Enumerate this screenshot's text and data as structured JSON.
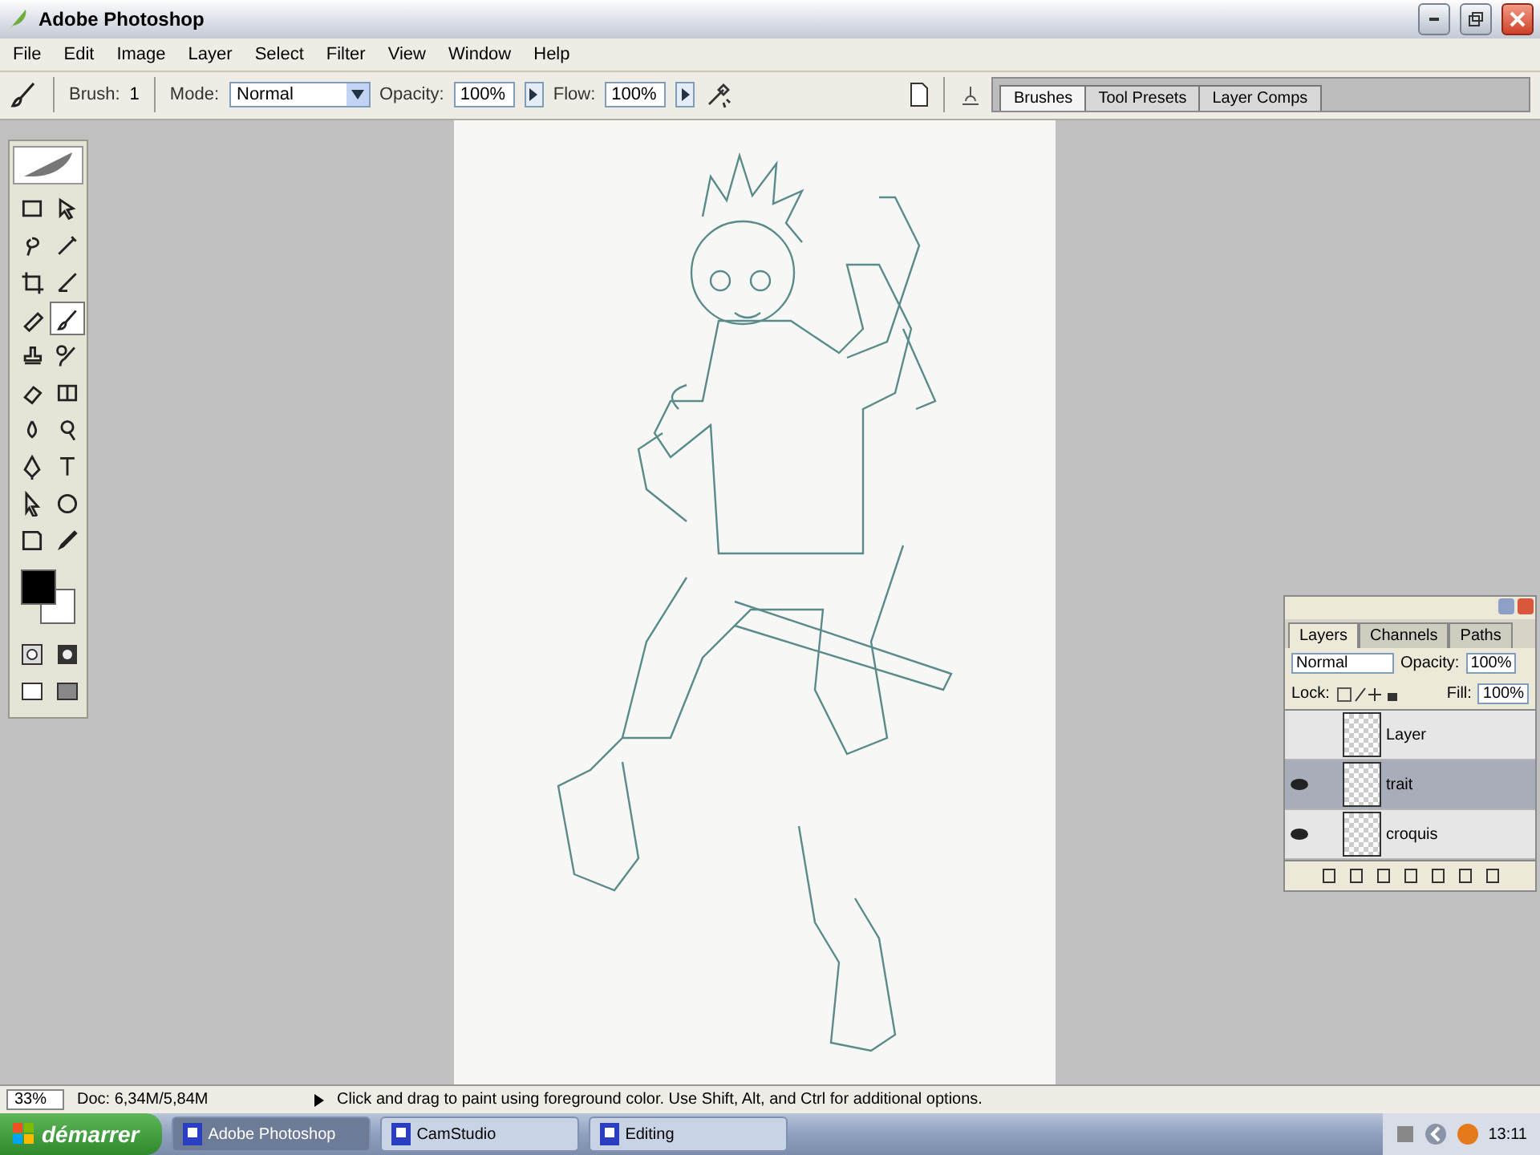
{
  "window": {
    "title": "Adobe Photoshop"
  },
  "menu": [
    "File",
    "Edit",
    "Image",
    "Layer",
    "Select",
    "Filter",
    "View",
    "Window",
    "Help"
  ],
  "options_bar": {
    "brush_label": "Brush:",
    "brush_size": "1",
    "mode_label": "Mode:",
    "mode": "Normal",
    "opacity_label": "Opacity:",
    "opacity": "100%",
    "flow_label": "Flow:",
    "flow": "100%"
  },
  "palette_well": [
    {
      "label": "Brushes",
      "selected": true
    },
    {
      "label": "Tool Presets",
      "selected": false
    },
    {
      "label": "Layer Comps",
      "selected": false
    }
  ],
  "toolbox": {
    "tools": [
      {
        "selected": false
      },
      {
        "selected": false
      },
      {
        "selected": false
      },
      {
        "selected": false
      },
      {
        "selected": false
      },
      {
        "selected": false
      },
      {
        "selected": false
      },
      {
        "selected": true
      },
      {
        "selected": false
      },
      {
        "selected": false
      },
      {
        "selected": false
      },
      {
        "selected": false
      },
      {
        "selected": false
      },
      {
        "selected": false
      },
      {
        "selected": false
      },
      {
        "selected": false
      },
      {
        "selected": false
      },
      {
        "selected": false
      },
      {
        "selected": false
      },
      {
        "selected": false
      }
    ]
  },
  "layers_panel": {
    "tabs": [
      {
        "label": "Layers",
        "selected": true
      },
      {
        "label": "Channels",
        "selected": false
      },
      {
        "label": "Paths",
        "selected": false
      }
    ],
    "blend_mode": "Normal",
    "opacity_label": "Opacity:",
    "opacity": "100%",
    "lock_label": "Lock:",
    "fill_label": "Fill:",
    "fill": "100%",
    "layers": [
      {
        "name": "Layer",
        "visible": false,
        "selected": false
      },
      {
        "name": "trait",
        "visible": true,
        "selected": true
      },
      {
        "name": "croquis",
        "visible": true,
        "selected": false
      }
    ]
  },
  "status_bar": {
    "zoom": "33%",
    "doc": "Doc: 6,34M/5,84M",
    "hint": "Click and drag to paint using foreground color. Use Shift, Alt, and Ctrl for additional options."
  },
  "taskbar": {
    "start": "démarrer",
    "tasks": [
      {
        "label": "Adobe Photoshop",
        "selected": true
      },
      {
        "label": "CamStudio",
        "selected": false
      },
      {
        "label": "Editing",
        "selected": false
      }
    ],
    "clock": "13:11"
  }
}
